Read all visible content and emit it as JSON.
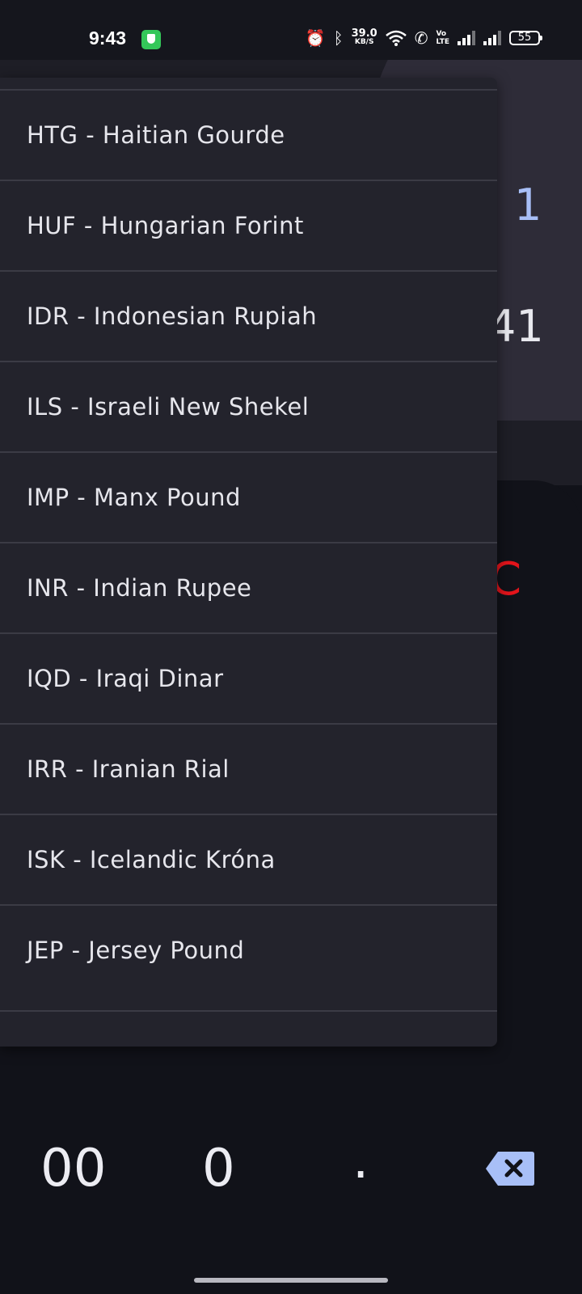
{
  "status_bar": {
    "time": "9:43",
    "speed_value": "39.0",
    "speed_unit": "KB/S",
    "volte_top": "Vo",
    "volte_bottom": "LTE",
    "battery": "55"
  },
  "background": {
    "amount_from": "1",
    "amount_to": "41",
    "clear_key": "C"
  },
  "currency_menu": {
    "items": [
      {
        "label": "HTG - Haitian Gourde"
      },
      {
        "label": "HUF - Hungarian Forint"
      },
      {
        "label": "IDR - Indonesian Rupiah"
      },
      {
        "label": "ILS - Israeli New Shekel"
      },
      {
        "label": "IMP - Manx Pound"
      },
      {
        "label": "INR - Indian Rupee"
      },
      {
        "label": "IQD - Iraqi Dinar"
      },
      {
        "label": "IRR - Iranian Rial"
      },
      {
        "label": "ISK - Icelandic Króna"
      },
      {
        "label": "JEP - Jersey Pound"
      }
    ]
  },
  "keypad": {
    "double_zero": "00",
    "zero": "0",
    "decimal": ".",
    "backspace_icon": "backspace-icon"
  },
  "colors": {
    "menu_background": "#23232c",
    "app_background": "#111219",
    "accent_blue": "#a8bff7",
    "clear_red": "#e3141b"
  }
}
